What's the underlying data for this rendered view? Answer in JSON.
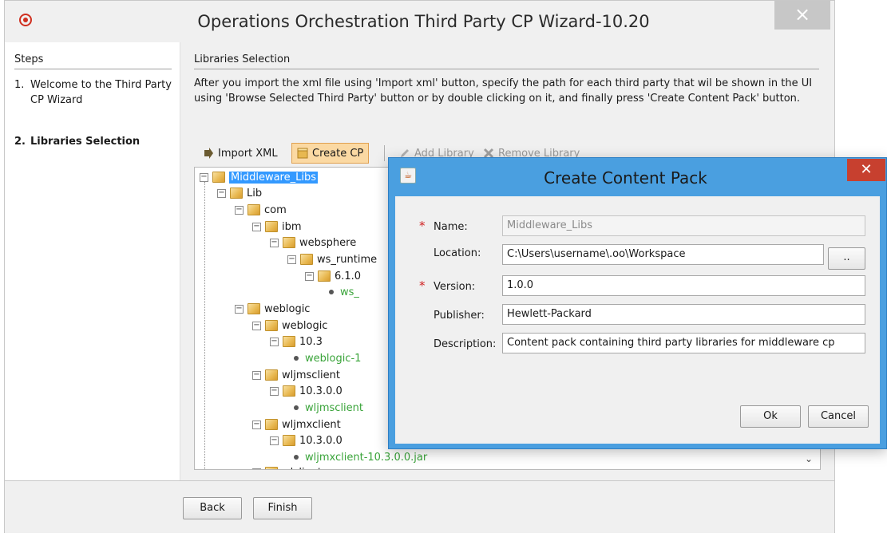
{
  "window": {
    "title": "Operations Orchestration Third Party CP Wizard-10.20",
    "close_glyph": "×"
  },
  "steps": {
    "header": "Steps",
    "items": [
      {
        "num": "1.",
        "label": "Welcome to the Third Party CP Wizard",
        "active": false
      },
      {
        "num": "2.",
        "label": "Libraries Selection",
        "active": true
      }
    ]
  },
  "content": {
    "header": "Libraries Selection",
    "description": "After you import the xml file using 'Import xml' button, specify the path for each third party that wil be shown in the UI using 'Browse Selected Third Party' button or by double clicking on it, and finally press 'Create Content Pack' button."
  },
  "toolbar": {
    "import_label": "Import XML",
    "create_label": "Create CP",
    "add_label": "Add Library",
    "remove_label": "Remove Library"
  },
  "tree": {
    "nodes": [
      {
        "label": "Middleware_Libs",
        "type": "folder",
        "selected": true
      },
      {
        "label": "Lib",
        "type": "folder"
      },
      {
        "label": "com",
        "type": "folder"
      },
      {
        "label": "ibm",
        "type": "folder"
      },
      {
        "label": "websphere",
        "type": "folder"
      },
      {
        "label": "ws_runtime",
        "type": "folder"
      },
      {
        "label": "6.1.0",
        "type": "folder"
      },
      {
        "label": "ws_",
        "type": "leaf"
      },
      {
        "label": "weblogic",
        "type": "folder"
      },
      {
        "label": "weblogic",
        "type": "folder"
      },
      {
        "label": "10.3",
        "type": "folder"
      },
      {
        "label": "weblogic-1",
        "type": "leaf"
      },
      {
        "label": "wljmsclient",
        "type": "folder"
      },
      {
        "label": "10.3.0.0",
        "type": "folder"
      },
      {
        "label": "wljmsclient",
        "type": "leaf"
      },
      {
        "label": "wljmxclient",
        "type": "folder"
      },
      {
        "label": "10.3.0.0",
        "type": "folder"
      },
      {
        "label": "wljmxclient-10.3.0.0.jar",
        "type": "leaf"
      },
      {
        "label": "wlclient",
        "type": "folder"
      }
    ]
  },
  "footer": {
    "back_label": "Back",
    "finish_label": "Finish"
  },
  "dialog": {
    "title": "Create Content Pack",
    "close_glyph": "✕",
    "fields": {
      "name": {
        "label": "Name:",
        "value": "Middleware_Libs",
        "required": true
      },
      "location": {
        "label": "Location:",
        "value": "C:\\Users\\username\\.oo\\Workspace"
      },
      "version": {
        "label": "Version:",
        "value": "1.0.0",
        "required": true
      },
      "publisher": {
        "label": "Publisher:",
        "value": "Hewlett-Packard"
      },
      "description": {
        "label": "Description:",
        "value": "Content pack containing third party libraries for middleware cp"
      }
    },
    "browse_label": "..",
    "ok_label": "Ok",
    "cancel_label": "Cancel"
  },
  "colors": {
    "dialog_frame": "#4a9fe0",
    "close_button": "#c7402f",
    "selection": "#3399ff",
    "leaf_text": "#3aa43a",
    "create_cp_highlight": "#fbd9a3"
  }
}
